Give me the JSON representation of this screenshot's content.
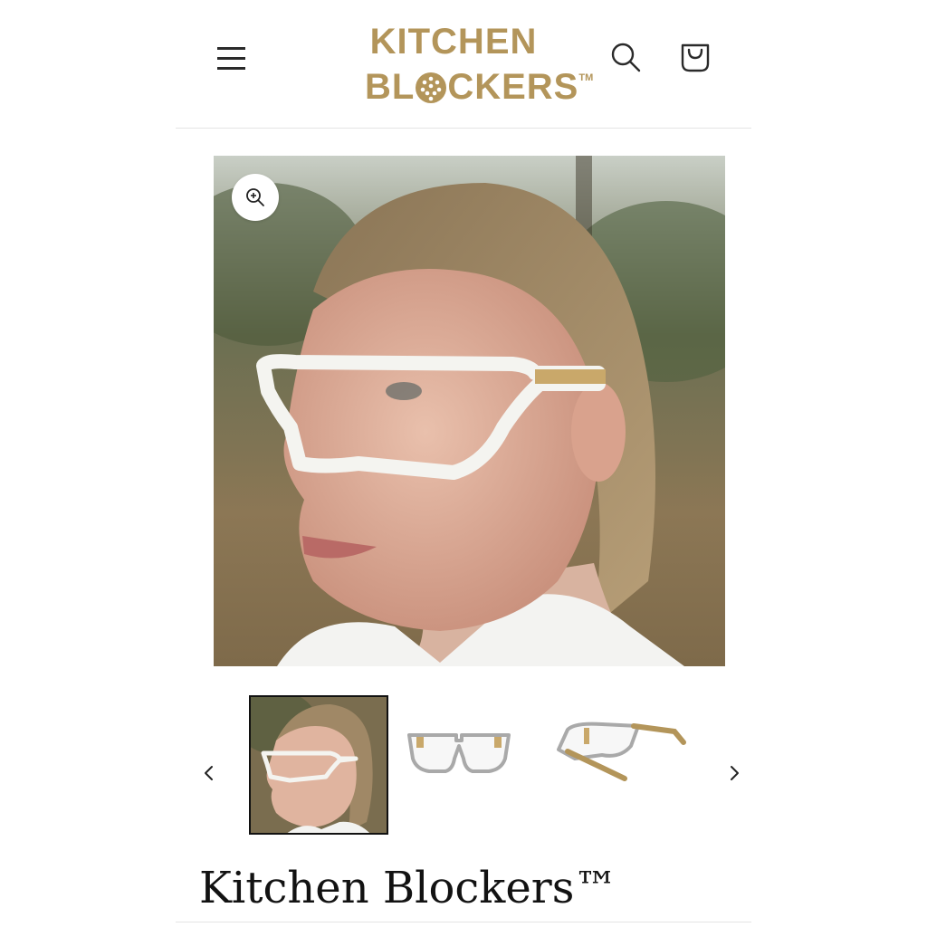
{
  "header": {
    "menu_icon": "hamburger-menu-icon",
    "logo": {
      "line1": "KITCHEN",
      "line2_left": "BL",
      "line2_right": "CKERS",
      "trademark": "TM"
    },
    "search_icon": "search-icon",
    "cart_icon": "cart-icon"
  },
  "gallery": {
    "zoom_icon": "zoom-in-icon",
    "main_image": "woman-wearing-white-protective-eyewear",
    "prev_icon": "chevron-left-icon",
    "next_icon": "chevron-right-icon",
    "thumbnails": [
      {
        "name": "woman-wearing-glasses",
        "active": true
      },
      {
        "name": "glasses-front-view",
        "active": false
      },
      {
        "name": "glasses-side-view",
        "active": false
      }
    ]
  },
  "product": {
    "title": "Kitchen Blockers™"
  },
  "colors": {
    "brand_gold": "#b3955a",
    "text": "#121212"
  }
}
